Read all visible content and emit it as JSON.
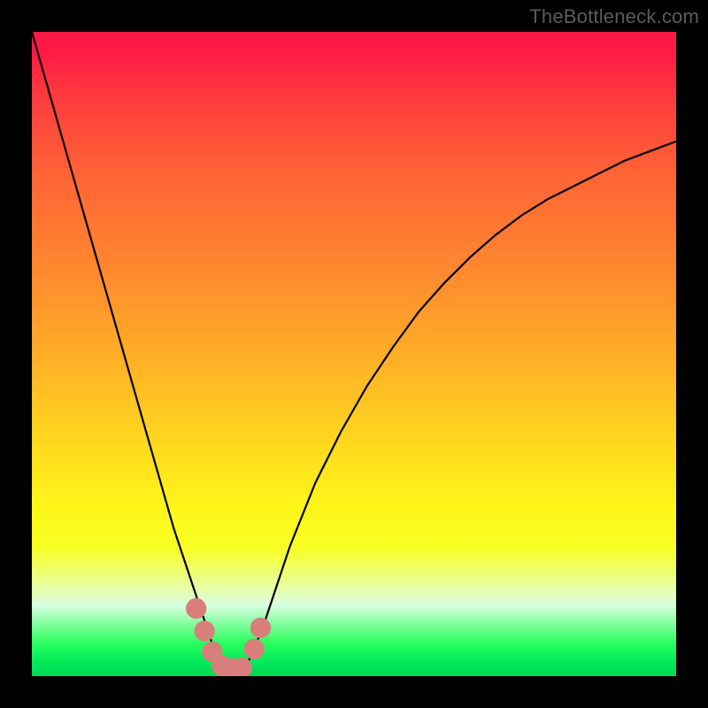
{
  "attribution": "TheBottleneck.com",
  "colors": {
    "curve": "#000000",
    "marker": "#d87f7c",
    "top": "#ff1a46",
    "bottom": "#00d856"
  },
  "chart_data": {
    "type": "line",
    "title": "",
    "xlabel": "",
    "ylabel": "",
    "xlim": [
      0,
      100
    ],
    "ylim": [
      0,
      100
    ],
    "grid": false,
    "legend": false,
    "note": "Values are in percent of plot area; y=0 is bottom (green), y=100 is top (red). The curve is a V-shape that falls steeply from top-left to a near-zero minimum around x≈28–33 and then rises, decelerating, toward the right edge.",
    "series": [
      {
        "name": "bottleneck-curve",
        "x": [
          0,
          2,
          4,
          6,
          8,
          10,
          12,
          14,
          16,
          18,
          20,
          22,
          24,
          26,
          27,
          28,
          29,
          30,
          31,
          32,
          33,
          34,
          36,
          38,
          40,
          44,
          48,
          52,
          56,
          60,
          64,
          68,
          72,
          76,
          80,
          84,
          88,
          92,
          96,
          100
        ],
        "y": [
          100,
          93,
          86,
          79,
          72,
          65,
          58,
          51,
          44,
          37,
          30,
          23,
          17,
          11,
          8,
          5,
          3,
          1.5,
          1,
          1,
          1.5,
          3,
          8,
          14,
          20,
          30,
          38,
          45,
          51,
          56.5,
          61,
          65,
          68.5,
          71.5,
          74,
          76,
          78,
          80,
          81.5,
          83
        ]
      }
    ],
    "markers": {
      "description": "Rounded pink blobs near the curve minimum",
      "points": [
        {
          "x": 25.5,
          "y": 10.5
        },
        {
          "x": 26.8,
          "y": 7.0
        },
        {
          "x": 28.0,
          "y": 3.8
        },
        {
          "x": 29.5,
          "y": 1.6
        },
        {
          "x": 31.0,
          "y": 1.2
        },
        {
          "x": 32.6,
          "y": 1.3
        },
        {
          "x": 34.5,
          "y": 4.2
        },
        {
          "x": 35.5,
          "y": 7.5
        }
      ],
      "radius_pct": 1.6
    }
  }
}
